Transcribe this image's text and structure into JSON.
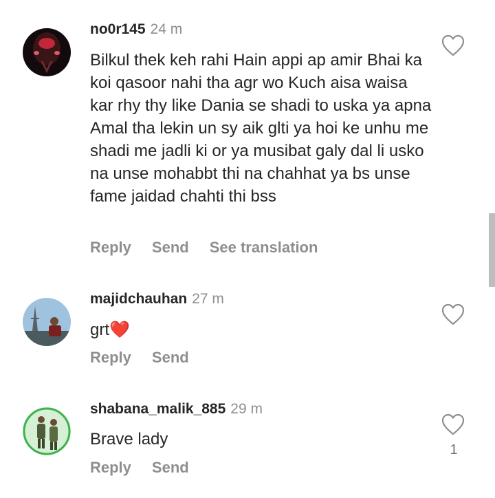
{
  "comments": [
    {
      "username": "no0r145",
      "time": "24 m",
      "text": "Bilkul thek keh rahi Hain appi ap amir Bhai ka koi qasoor nahi tha agr wo Kuch aisa waisa kar rhy thy like Dania se shadi to uska ya apna Amal tha lekin un sy aik glti ya hoi ke unhu me shadi me jadli ki or ya musibat galy dal li usko na unse mohabbt thi na chahhat ya bs unse fame jaidad chahti thi bss",
      "actions": {
        "reply": "Reply",
        "send": "Send",
        "translate": "See translation"
      },
      "likes": ""
    },
    {
      "username": "majidchauhan",
      "time": "27 m",
      "text": "grt❤️",
      "actions": {
        "reply": "Reply",
        "send": "Send"
      },
      "likes": ""
    },
    {
      "username": "shabana_malik_885",
      "time": "29 m",
      "text": "Brave lady",
      "actions": {
        "reply": "Reply",
        "send": "Send"
      },
      "likes": "1"
    }
  ],
  "icons": {
    "like": "heart-outline-icon"
  },
  "colors": {
    "text": "#262626",
    "secondary": "#8e8e8e",
    "background": "#ffffff"
  }
}
